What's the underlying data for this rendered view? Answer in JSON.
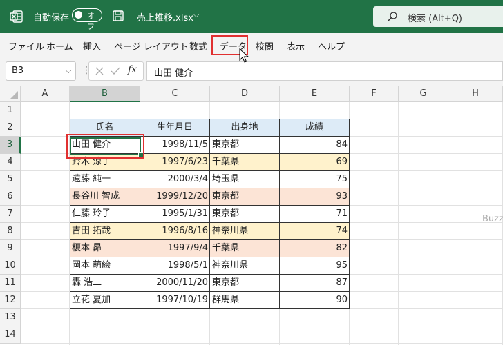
{
  "titlebar": {
    "autosave_label": "自動保存",
    "autosave_state": "オフ",
    "file_name": "売上推移.xlsx",
    "search_placeholder": "検索 (Alt+Q)"
  },
  "menu": [
    {
      "label": "ファイル"
    },
    {
      "label": "ホーム"
    },
    {
      "label": "挿入"
    },
    {
      "label": "ページ レイアウト"
    },
    {
      "label": "数式"
    },
    {
      "label": "データ",
      "highlighted": true
    },
    {
      "label": "校閲"
    },
    {
      "label": "表示"
    },
    {
      "label": "ヘルプ"
    }
  ],
  "formula_bar": {
    "name_box": "B3",
    "fx_label": "fx",
    "formula": "山田 健介"
  },
  "columns": [
    "A",
    "B",
    "C",
    "D",
    "E",
    "F",
    "G",
    "H"
  ],
  "rows": [
    "1",
    "2",
    "3",
    "4",
    "5",
    "6",
    "7",
    "8",
    "9",
    "10",
    "11",
    "12",
    "13",
    "14"
  ],
  "selected_column": "B",
  "selected_row": "3",
  "table": {
    "headers": [
      "氏名",
      "生年月日",
      "出身地",
      "成績"
    ],
    "records": [
      [
        "山田 健介",
        "1998/11/5",
        "東京都",
        "84"
      ],
      [
        "鈴木 涼子",
        "1997/6/23",
        "千葉県",
        "69"
      ],
      [
        "遠藤 純一",
        "2000/3/4",
        "埼玉県",
        "75"
      ],
      [
        "長谷川 智成",
        "1999/12/20",
        "東京都",
        "93"
      ],
      [
        "仁藤 玲子",
        "1995/1/31",
        "東京都",
        "71"
      ],
      [
        "吉田 拓哉",
        "1996/8/16",
        "神奈川県",
        "74"
      ],
      [
        "榎本 昴",
        "1997/9/4",
        "千葉県",
        "82"
      ],
      [
        "岡本 萌絵",
        "1998/5/1",
        "神奈川県",
        "95"
      ],
      [
        "轟 浩二",
        "2000/11/20",
        "東京都",
        "87"
      ],
      [
        "立花 夏加",
        "1997/10/19",
        "群馬県",
        "90"
      ]
    ],
    "row_fills": [
      "none",
      "yellow",
      "none",
      "pink",
      "none",
      "yellow",
      "pink",
      "none",
      "none",
      "none"
    ]
  },
  "colors": {
    "title_bar": "#217346",
    "header_fill": "#ddebf7",
    "yellow_fill": "#fff2cc",
    "pink_fill": "#fce4d6",
    "highlight": "#e03030"
  },
  "watermark": "Buzz"
}
